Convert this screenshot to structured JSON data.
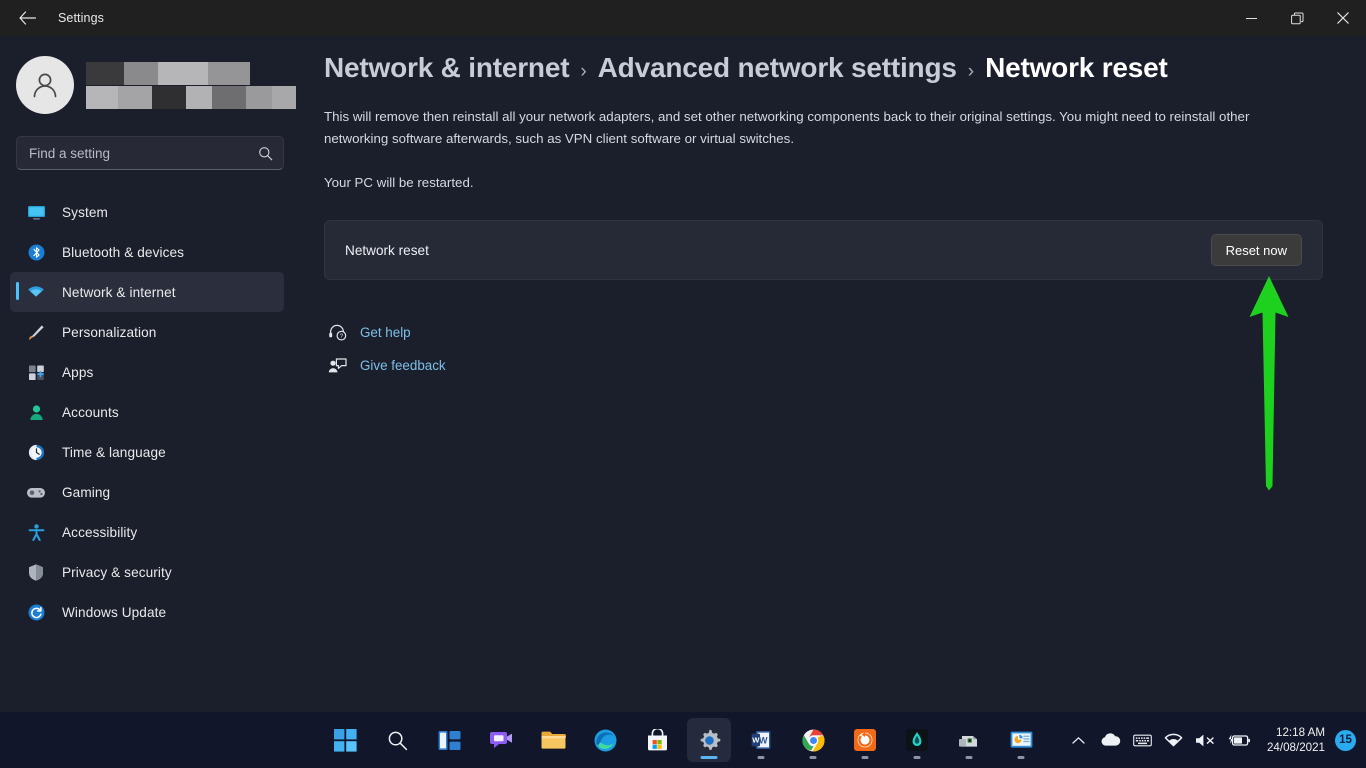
{
  "window": {
    "title": "Settings",
    "back_icon": "back-arrow-icon",
    "controls": {
      "minimize": "minimize-icon",
      "maximize": "restore-icon",
      "close": "close-icon"
    }
  },
  "sidebar": {
    "account": {
      "avatar_icon": "user-avatar-icon",
      "name_redacted": true
    },
    "search": {
      "placeholder": "Find a setting",
      "value": "",
      "icon": "search-icon"
    },
    "items": [
      {
        "label": "System",
        "icon": "monitor-icon",
        "selected": false
      },
      {
        "label": "Bluetooth & devices",
        "icon": "bluetooth-icon",
        "selected": false
      },
      {
        "label": "Network & internet",
        "icon": "wifi-icon",
        "selected": true
      },
      {
        "label": "Personalization",
        "icon": "paintbrush-icon",
        "selected": false
      },
      {
        "label": "Apps",
        "icon": "apps-grid-icon",
        "selected": false
      },
      {
        "label": "Accounts",
        "icon": "person-icon",
        "selected": false
      },
      {
        "label": "Time & language",
        "icon": "clock-globe-icon",
        "selected": false
      },
      {
        "label": "Gaming",
        "icon": "gamepad-icon",
        "selected": false
      },
      {
        "label": "Accessibility",
        "icon": "accessibility-icon",
        "selected": false
      },
      {
        "label": "Privacy & security",
        "icon": "shield-icon",
        "selected": false
      },
      {
        "label": "Windows Update",
        "icon": "update-refresh-icon",
        "selected": false
      }
    ]
  },
  "main": {
    "breadcrumb": [
      {
        "label": "Network & internet",
        "current": false
      },
      {
        "label": "Advanced network settings",
        "current": false
      },
      {
        "label": "Network reset",
        "current": true
      }
    ],
    "breadcrumb_separator": "›",
    "description": "This will remove then reinstall all your network adapters, and set other networking components back to their original settings. You might need to reinstall other networking software afterwards, such as VPN client software or virtual switches.",
    "description_2": "Your PC will be restarted.",
    "card": {
      "label": "Network reset",
      "button_label": "Reset now"
    },
    "links": [
      {
        "label": "Get help",
        "icon": "get-help-icon"
      },
      {
        "label": "Give feedback",
        "icon": "give-feedback-icon"
      }
    ],
    "annotation": {
      "shape": "up-arrow",
      "color": "#1fd11f",
      "points_to": "Reset now"
    }
  },
  "taskbar": {
    "apps": [
      {
        "name": "start",
        "active": false,
        "running": false
      },
      {
        "name": "search",
        "active": false,
        "running": false
      },
      {
        "name": "task-view",
        "active": false,
        "running": false
      },
      {
        "name": "chat-teams",
        "active": false,
        "running": false
      },
      {
        "name": "file-explorer",
        "active": false,
        "running": true
      },
      {
        "name": "microsoft-edge",
        "active": false,
        "running": true
      },
      {
        "name": "microsoft-store",
        "active": false,
        "running": false
      },
      {
        "name": "settings",
        "active": true,
        "running": true
      },
      {
        "name": "microsoft-word",
        "active": false,
        "running": true
      },
      {
        "name": "google-chrome",
        "active": false,
        "running": true
      },
      {
        "name": "orange-app",
        "active": false,
        "running": true
      },
      {
        "name": "dark-flame-app",
        "active": false,
        "running": true
      },
      {
        "name": "printer-app",
        "active": false,
        "running": true
      },
      {
        "name": "presentation-app",
        "active": false,
        "running": true
      }
    ],
    "tray": {
      "chevron": "chevron-up-icon",
      "onedrive": "cloud-icon",
      "keyboard": "keyboard-icon",
      "network": "wifi-icon",
      "volume": "speaker-muted-icon",
      "battery": "battery-charging-icon",
      "time": "12:18 AM",
      "date": "24/08/2021",
      "notification_count": "15"
    }
  },
  "colors": {
    "window_bg": "#1b1e2b",
    "titlebar_bg": "#202020",
    "accent": "#4cc2ff",
    "link": "#7cc0e8",
    "card_bg": "#262a37",
    "button_bg": "#3b3b3b",
    "taskbar_bg": "#11162a",
    "annotation_green": "#1fd11f",
    "badge_blue": "#2aabf0"
  }
}
